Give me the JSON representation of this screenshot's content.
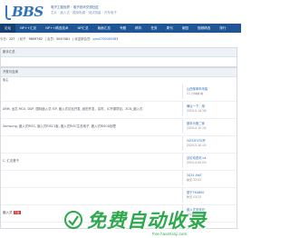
{
  "header": {
    "logo_text": "BBS",
    "slogan_line1": "电子工程世界 · 电子技术交流社区",
    "slogan_line2": "芯片 · 嵌入式 · 模拟电源 · 测试测量 · 汽车电子"
  },
  "nav": {
    "items": [
      {
        "label": "论坛",
        "active": true
      },
      {
        "label": "NP++汇总",
        "active": false
      },
      {
        "label": "NP++精选技术",
        "active": false
      },
      {
        "label": "NP汇总",
        "active": false
      },
      {
        "label": "版面汇总",
        "active": false
      },
      {
        "label": "专题",
        "active": false
      },
      {
        "label": "精华",
        "active": false
      },
      {
        "label": "任务",
        "active": false
      },
      {
        "label": "周刊",
        "active": false
      },
      {
        "label": "家园",
        "active": false
      },
      {
        "label": "视频精选",
        "active": false
      },
      {
        "label": "排行",
        "active": false
      }
    ]
  },
  "meta": {
    "prefix": "今日:",
    "today": "227",
    "posts_label": "|  帖子:",
    "posts": "9809782",
    "members_label": "|  会员:",
    "members": "5047481",
    "newest_label": "|  欢迎新会员:",
    "newest": "pjrs0700080383"
  },
  "section1": {
    "title": "新手汇总"
  },
  "section2": {
    "title": "开发与应用",
    "subhead": "版主",
    "rows": [
      {
        "desc": "",
        "last_title": "山西某单车改装",
        "last_date": "21 分钟前 前"
      },
      {
        "desc": "ARM, 龙芯 MCU, DSP, 国际嵌入式 ISP, 嵌入式论坛开发, 经历开发，实时、IC开源项目，ZCN_嵌入式",
        "last_title": "确认一下，用",
        "last_date": "2024-5-14 18:"
      },
      {
        "desc": "Samsung, 嵌入式RISC, 嵌入式RISC1板, 嵌入式RISC生态电子, 嵌入式RISC8处理",
        "last_title": "基本为第二家",
        "last_date": "2024-4-10 10:"
      },
      {
        "desc": "",
        "last_title": "GD32F470开",
        "last_date": "2024-5-18 10:"
      },
      {
        "desc": "C, 汇总基于",
        "last_title": "谈论动态化 ca",
        "last_date": "2024-4-04 03:"
      },
      {
        "desc": "",
        "last_title": "2024 AIoT",
        "last_date": "前天 22:41"
      },
      {
        "desc": "",
        "last_title": "基于TKABS0",
        "last_date": "昨天 03:22"
      },
      {
        "desc": "",
        "last_title": "嵌入式无线可",
        "last_date": "2024-5-10 10:"
      }
    ],
    "tag_label": "嵌入式",
    "tag_badge": "下载"
  },
  "watermark": {
    "text": "免费自动收录",
    "url": "free.haozhanji.com"
  },
  "colors": {
    "nav_bg": "#1f5595",
    "brand": "#2f6fbf",
    "watermark": "#2ea84d"
  }
}
